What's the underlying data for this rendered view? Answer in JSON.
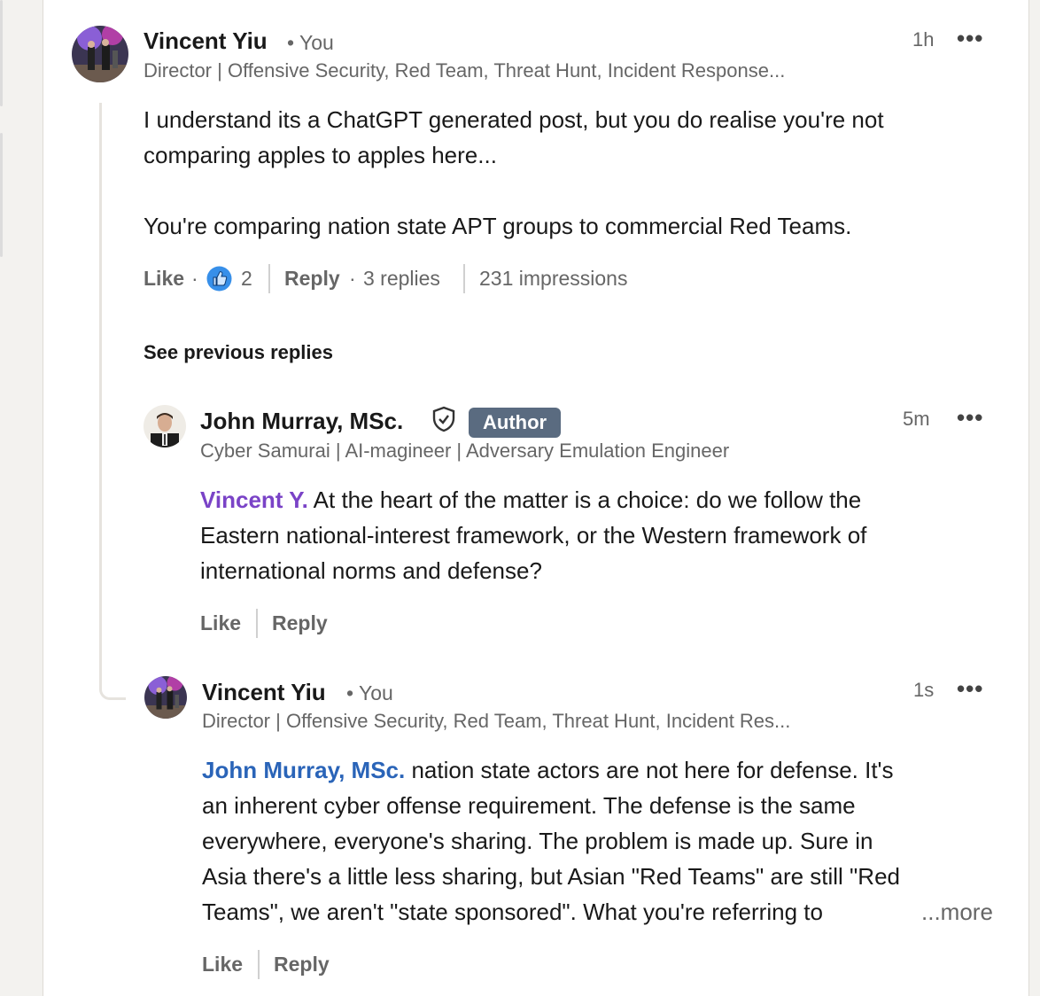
{
  "colors": {
    "mention_purple": "#7a43c7",
    "mention_blue": "#2a64b8",
    "author_badge_bg": "#5a6b80",
    "like_icon_blue": "#378fe9"
  },
  "comment": {
    "author": "Vincent Yiu",
    "you_label": "• You",
    "headline": "Director | Offensive Security, Red Team, Threat Hunt, Incident Response...",
    "time": "1h",
    "more_icon": "•••",
    "text_line1": "I understand its a ChatGPT generated post, but you do realise you're not",
    "text_line2": "comparing apples to apples here...",
    "text_line3": "You're comparing nation state APT groups to commercial Red Teams.",
    "like_label": "Like",
    "dot": "·",
    "reaction_icon": "thumbs-up-icon",
    "reaction_count": "2",
    "reply_label": "Reply",
    "replies_count": "3 replies",
    "impressions": "231 impressions"
  },
  "see_previous": "See previous replies",
  "reply1": {
    "author": "John Murray, MSc.",
    "verified_icon": "shield-check-icon",
    "badge": "Author",
    "headline": "Cyber Samurai | AI-magineer | Adversary Emulation Engineer",
    "time": "5m",
    "more_icon": "•••",
    "mention": "Vincent Y.",
    "text_line1": " At the heart of the matter is a choice: do we follow the",
    "text_line2": "Eastern national-interest framework, or the Western framework of",
    "text_line3": "international norms and defense?",
    "like_label": "Like",
    "reply_label": "Reply"
  },
  "reply2": {
    "author": "Vincent Yiu",
    "you_label": "• You",
    "headline": "Director | Offensive Security, Red Team, Threat Hunt, Incident Res...",
    "time": "1s",
    "more_icon": "•••",
    "mention": "John Murray, MSc.",
    "text_line1": " nation state actors are not here for defense. It's",
    "text_line2": "an inherent cyber offense requirement. The defense is the same",
    "text_line3": "everywhere, everyone's sharing. The problem is made up. Sure in",
    "text_line4": "Asia there's a little less sharing, but Asian \"Red Teams\" are still \"Red",
    "text_line5": "Teams\", we aren't \"state sponsored\". What you're referring to",
    "more_link": "...more",
    "like_label": "Like",
    "reply_label": "Reply"
  }
}
